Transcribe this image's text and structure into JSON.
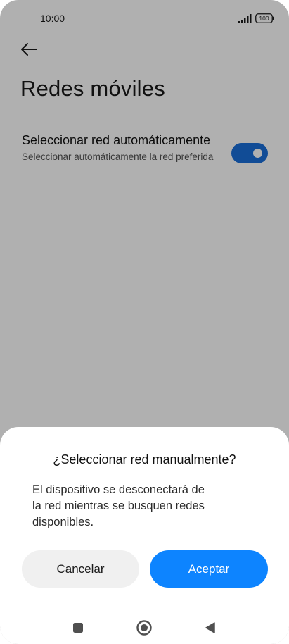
{
  "status_bar": {
    "time": "10:00",
    "battery": "100"
  },
  "header": {
    "back_icon": "arrow-left-icon",
    "title": "Redes móviles"
  },
  "setting": {
    "title": "Seleccionar red automáticamente",
    "subtitle": "Seleccionar automáticamente la red preferida",
    "toggle_on": true,
    "accent_color": "#1a6fd9"
  },
  "dialog": {
    "title": "¿Seleccionar red manualmente?",
    "message_lines": [
      "El dispositivo se desconectará de",
      "la red mientras se busquen redes",
      "disponibles."
    ],
    "cancel_label": "Cancelar",
    "accept_label": "Aceptar",
    "accept_color": "#0d84ff"
  },
  "nav_bar": {
    "icons": [
      "recents-square-icon",
      "home-circle-icon",
      "back-triangle-icon"
    ]
  }
}
